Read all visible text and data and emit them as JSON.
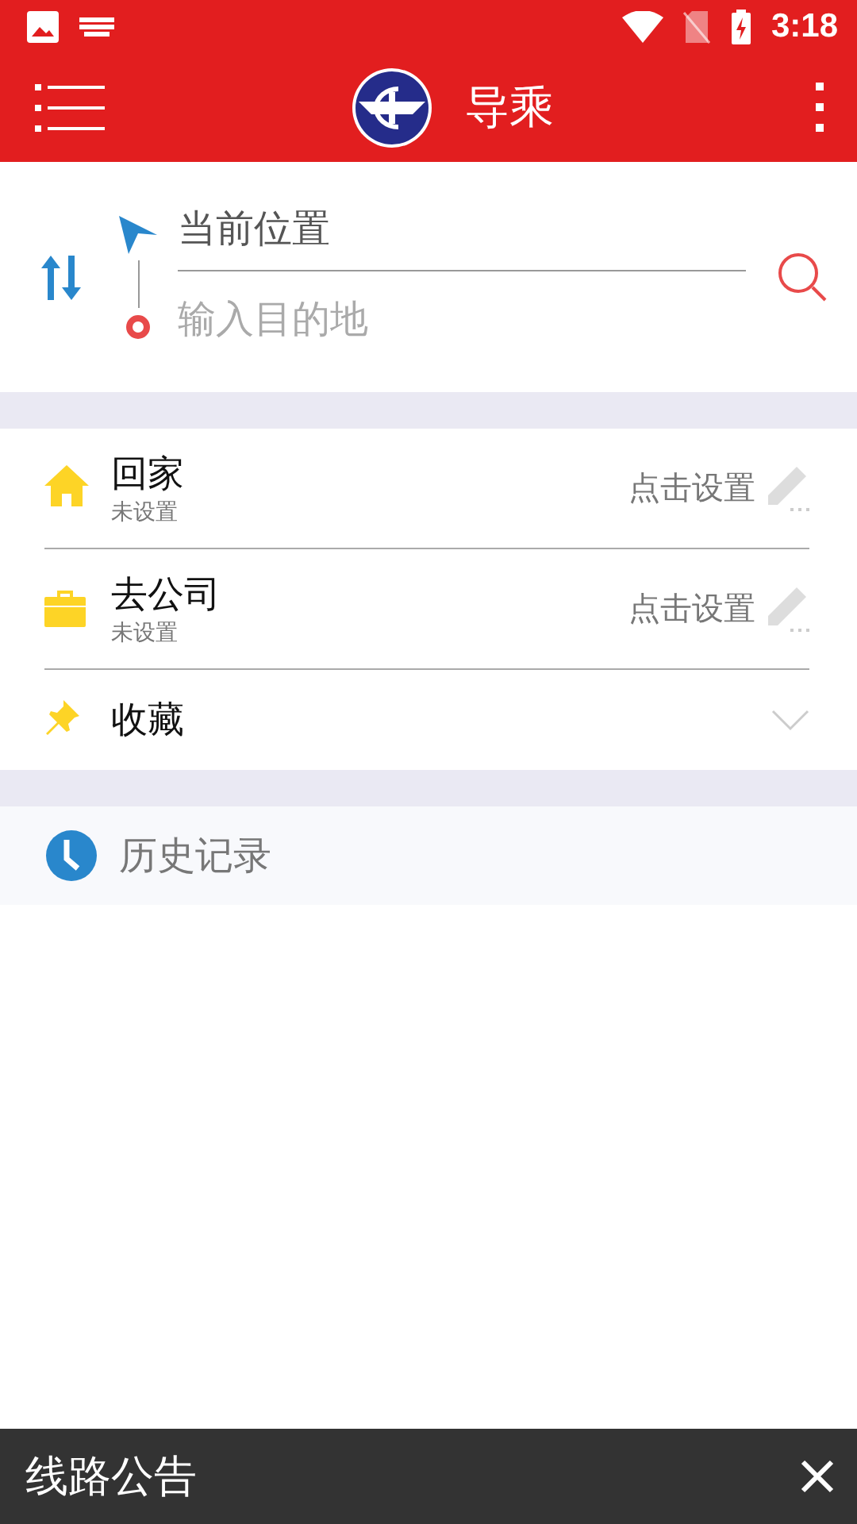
{
  "status_bar": {
    "time": "3:18"
  },
  "app_bar": {
    "title": "导乘"
  },
  "route": {
    "from": "当前位置",
    "to_placeholder": "输入目的地"
  },
  "shortcuts": [
    {
      "kind": "home",
      "title": "回家",
      "subtitle": "未设置",
      "action": "点击设置"
    },
    {
      "kind": "work",
      "title": "去公司",
      "subtitle": "未设置",
      "action": "点击设置"
    },
    {
      "kind": "favorites",
      "title": "收藏"
    }
  ],
  "history": {
    "label": "历史记录"
  },
  "notice_bar": {
    "title": "线路公告"
  }
}
